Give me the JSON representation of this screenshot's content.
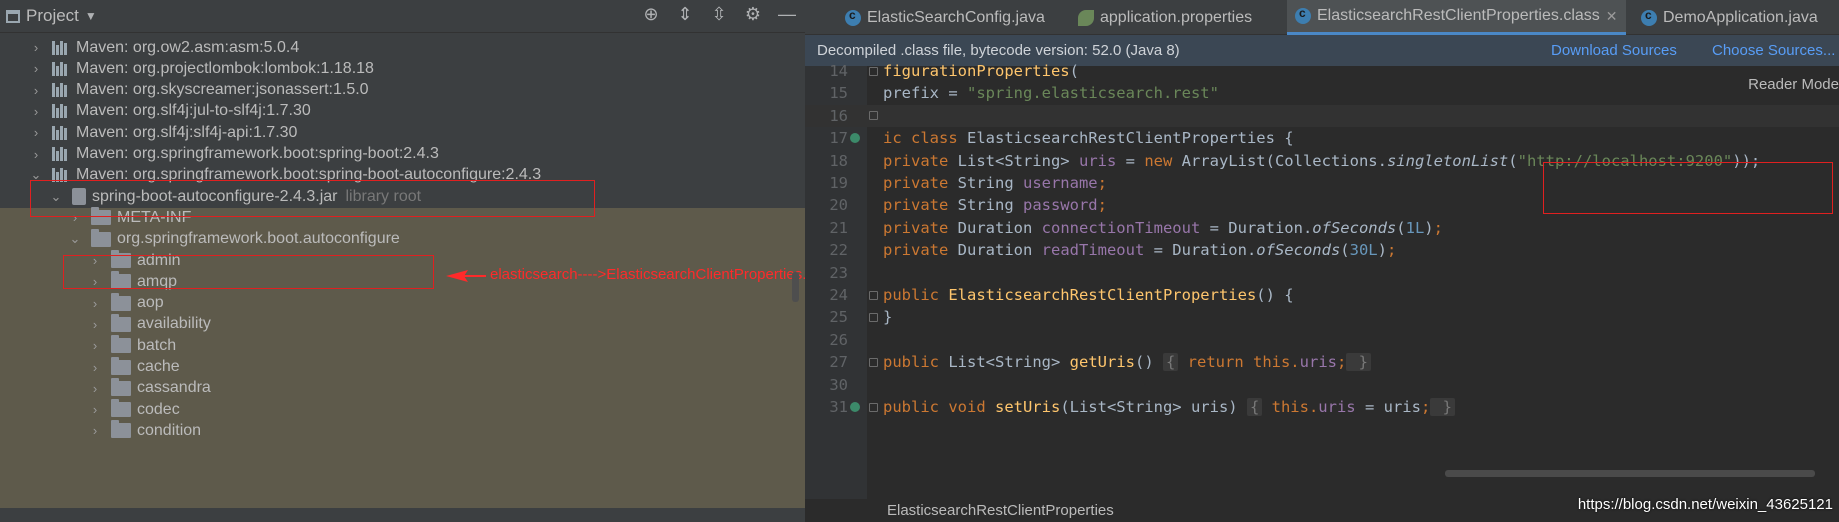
{
  "project_panel": {
    "title": "Project",
    "icons": [
      "crosshair-icon",
      "expand-all-icon",
      "collapse-all-icon",
      "gear-icon",
      "minimize-icon"
    ],
    "tree": [
      {
        "label": "Maven: org.ow2.asm:asm:5.0.4",
        "type": "library",
        "expanded": false
      },
      {
        "label": "Maven: org.projectlombok:lombok:1.18.18",
        "type": "library",
        "expanded": false
      },
      {
        "label": "Maven: org.skyscreamer:jsonassert:1.5.0",
        "type": "library",
        "expanded": false
      },
      {
        "label": "Maven: org.slf4j:jul-to-slf4j:1.7.30",
        "type": "library",
        "expanded": false
      },
      {
        "label": "Maven: org.slf4j:slf4j-api:1.7.30",
        "type": "library",
        "expanded": false
      },
      {
        "label": "Maven: org.springframework.boot:spring-boot:2.4.3",
        "type": "library",
        "expanded": false
      },
      {
        "label": "Maven: org.springframework.boot:spring-boot-autoconfigure:2.4.3",
        "type": "library",
        "expanded": true
      },
      {
        "label": "spring-boot-autoconfigure-2.4.3.jar",
        "suffix": "library root",
        "type": "jar",
        "expanded": true
      },
      {
        "label": "META-INF",
        "type": "folder",
        "expanded": false
      },
      {
        "label": "org.springframework.boot.autoconfigure",
        "type": "folder",
        "expanded": true
      },
      {
        "label": "admin",
        "type": "folder",
        "expanded": false
      },
      {
        "label": "amqp",
        "type": "folder",
        "expanded": false
      },
      {
        "label": "aop",
        "type": "folder",
        "expanded": false
      },
      {
        "label": "availability",
        "type": "folder",
        "expanded": false
      },
      {
        "label": "batch",
        "type": "folder",
        "expanded": false
      },
      {
        "label": "cache",
        "type": "folder",
        "expanded": false
      },
      {
        "label": "cassandra",
        "type": "folder",
        "expanded": false
      },
      {
        "label": "codec",
        "type": "folder",
        "expanded": false
      },
      {
        "label": "condition",
        "type": "folder",
        "expanded": false
      }
    ],
    "annotation": "elasticsearch---->ElasticsearchClientProperties.class"
  },
  "editor": {
    "tabs": [
      {
        "label": "ElasticSearchConfig.java",
        "icon": "class-icon",
        "active": false
      },
      {
        "label": "application.properties",
        "icon": "spring-leaf-icon",
        "active": false
      },
      {
        "label": "ElasticsearchRestClientProperties.class",
        "icon": "class-icon",
        "active": true
      },
      {
        "label": "DemoApplication.java",
        "icon": "class-icon",
        "active": false
      }
    ],
    "banner": {
      "message": "Decompiled .class file, bytecode version: 52.0 (Java 8)",
      "download": "Download Sources",
      "choose": "Choose Sources..."
    },
    "reader_mode": "Reader Mode",
    "lines": [
      {
        "n": "14",
        "tokens": [
          [
            "t",
            "figurationProperties"
          ],
          [
            "p",
            "("
          ]
        ]
      },
      {
        "n": "15",
        "tokens": [
          [
            "p",
            "prefix = "
          ],
          [
            "s",
            "\"spring.elasticsearch.rest\""
          ]
        ]
      },
      {
        "n": "16",
        "tokens": []
      },
      {
        "n": "17",
        "tokens": [
          [
            "k",
            "ic class "
          ],
          [
            "p",
            "ElasticsearchRestClientProperties {"
          ]
        ]
      },
      {
        "n": "18",
        "tokens": [
          [
            "k",
            "private "
          ],
          [
            "p",
            "List<String> "
          ],
          [
            "f",
            "uris"
          ],
          [
            "p",
            " = "
          ],
          [
            "k",
            "new "
          ],
          [
            "p",
            "ArrayList(Collections."
          ],
          [
            "i",
            "singletonList"
          ],
          [
            "p",
            "("
          ],
          [
            "s",
            "\"http://localhost:9200\""
          ],
          [
            "p",
            "));"
          ]
        ]
      },
      {
        "n": "19",
        "tokens": [
          [
            "k",
            "private "
          ],
          [
            "p",
            "String "
          ],
          [
            "f",
            "username"
          ],
          [
            "k",
            ";"
          ]
        ]
      },
      {
        "n": "20",
        "tokens": [
          [
            "k",
            "private "
          ],
          [
            "p",
            "String "
          ],
          [
            "f",
            "password"
          ],
          [
            "k",
            ";"
          ]
        ]
      },
      {
        "n": "21",
        "tokens": [
          [
            "k",
            "private "
          ],
          [
            "p",
            "Duration "
          ],
          [
            "f",
            "connectionTimeout"
          ],
          [
            "p",
            " = Duration."
          ],
          [
            "i",
            "ofSeconds"
          ],
          [
            "p",
            "("
          ],
          [
            "n",
            "1L"
          ],
          [
            "p",
            ")"
          ],
          [
            "k",
            ";"
          ]
        ]
      },
      {
        "n": "22",
        "tokens": [
          [
            "k",
            "private "
          ],
          [
            "p",
            "Duration "
          ],
          [
            "f",
            "readTimeout"
          ],
          [
            "p",
            " = Duration."
          ],
          [
            "i",
            "ofSeconds"
          ],
          [
            "p",
            "("
          ],
          [
            "n",
            "30L"
          ],
          [
            "p",
            ")"
          ],
          [
            "k",
            ";"
          ]
        ]
      },
      {
        "n": "23",
        "tokens": []
      },
      {
        "n": "24",
        "tokens": [
          [
            "k",
            "public "
          ],
          [
            "m",
            "ElasticsearchRestClientProperties"
          ],
          [
            "p",
            "() {"
          ]
        ]
      },
      {
        "n": "25",
        "tokens": [
          [
            "p",
            "}"
          ]
        ]
      },
      {
        "n": "26",
        "tokens": []
      },
      {
        "n": "27",
        "tokens": [
          [
            "k",
            "public "
          ],
          [
            "p",
            "List<String> "
          ],
          [
            "m",
            "getUris"
          ],
          [
            "p",
            "() "
          ],
          [
            "b",
            "{"
          ],
          [
            "k",
            " return this."
          ],
          [
            "f",
            "uris"
          ],
          [
            "k",
            ";"
          ],
          [
            "b",
            " }"
          ]
        ]
      },
      {
        "n": "30",
        "tokens": []
      },
      {
        "n": "31",
        "tokens": [
          [
            "k",
            "public void "
          ],
          [
            "m",
            "setUris"
          ],
          [
            "p",
            "(List<String> uris) "
          ],
          [
            "b",
            "{"
          ],
          [
            "k",
            " this."
          ],
          [
            "f",
            "uris"
          ],
          [
            "p",
            " = uris"
          ],
          [
            "k",
            ";"
          ],
          [
            "b",
            " }"
          ]
        ]
      }
    ],
    "status_text": "ElasticsearchRestClientProperties"
  },
  "watermark": "https://blog.csdn.net/weixin_43625121"
}
